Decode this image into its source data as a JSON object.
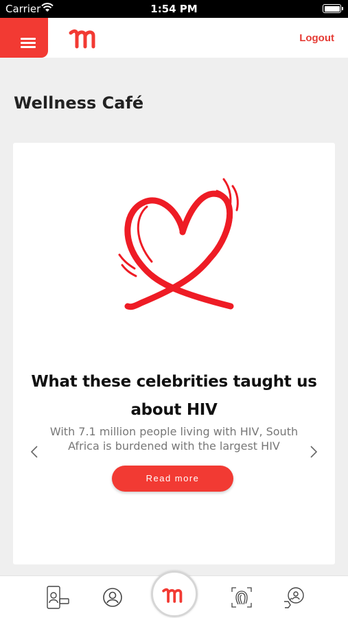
{
  "status_bar": {
    "carrier": "Carrier",
    "time": "1:54 PM"
  },
  "header": {
    "menu_icon": "hamburger-menu-icon",
    "logo_icon": "brand-m-logo",
    "logout_label": "Logout",
    "accent_color": "#f23a33"
  },
  "page": {
    "title": "Wellness Café"
  },
  "card": {
    "image_icon": "heart-ribbon-illustration",
    "title": "What these celebrities taught us about HIV",
    "excerpt": "With 7.1 million people living with HIV, South Africa is burdened with the largest HIV",
    "read_more_label": "Read more",
    "prev_icon": "chevron-left-icon",
    "next_icon": "chevron-right-icon"
  },
  "bottom_nav": {
    "items": [
      {
        "icon": "phone-card-icon"
      },
      {
        "icon": "profile-icon"
      },
      {
        "icon": "brand-m-logo"
      },
      {
        "icon": "fingerprint-icon"
      },
      {
        "icon": "consultation-icon"
      }
    ]
  }
}
